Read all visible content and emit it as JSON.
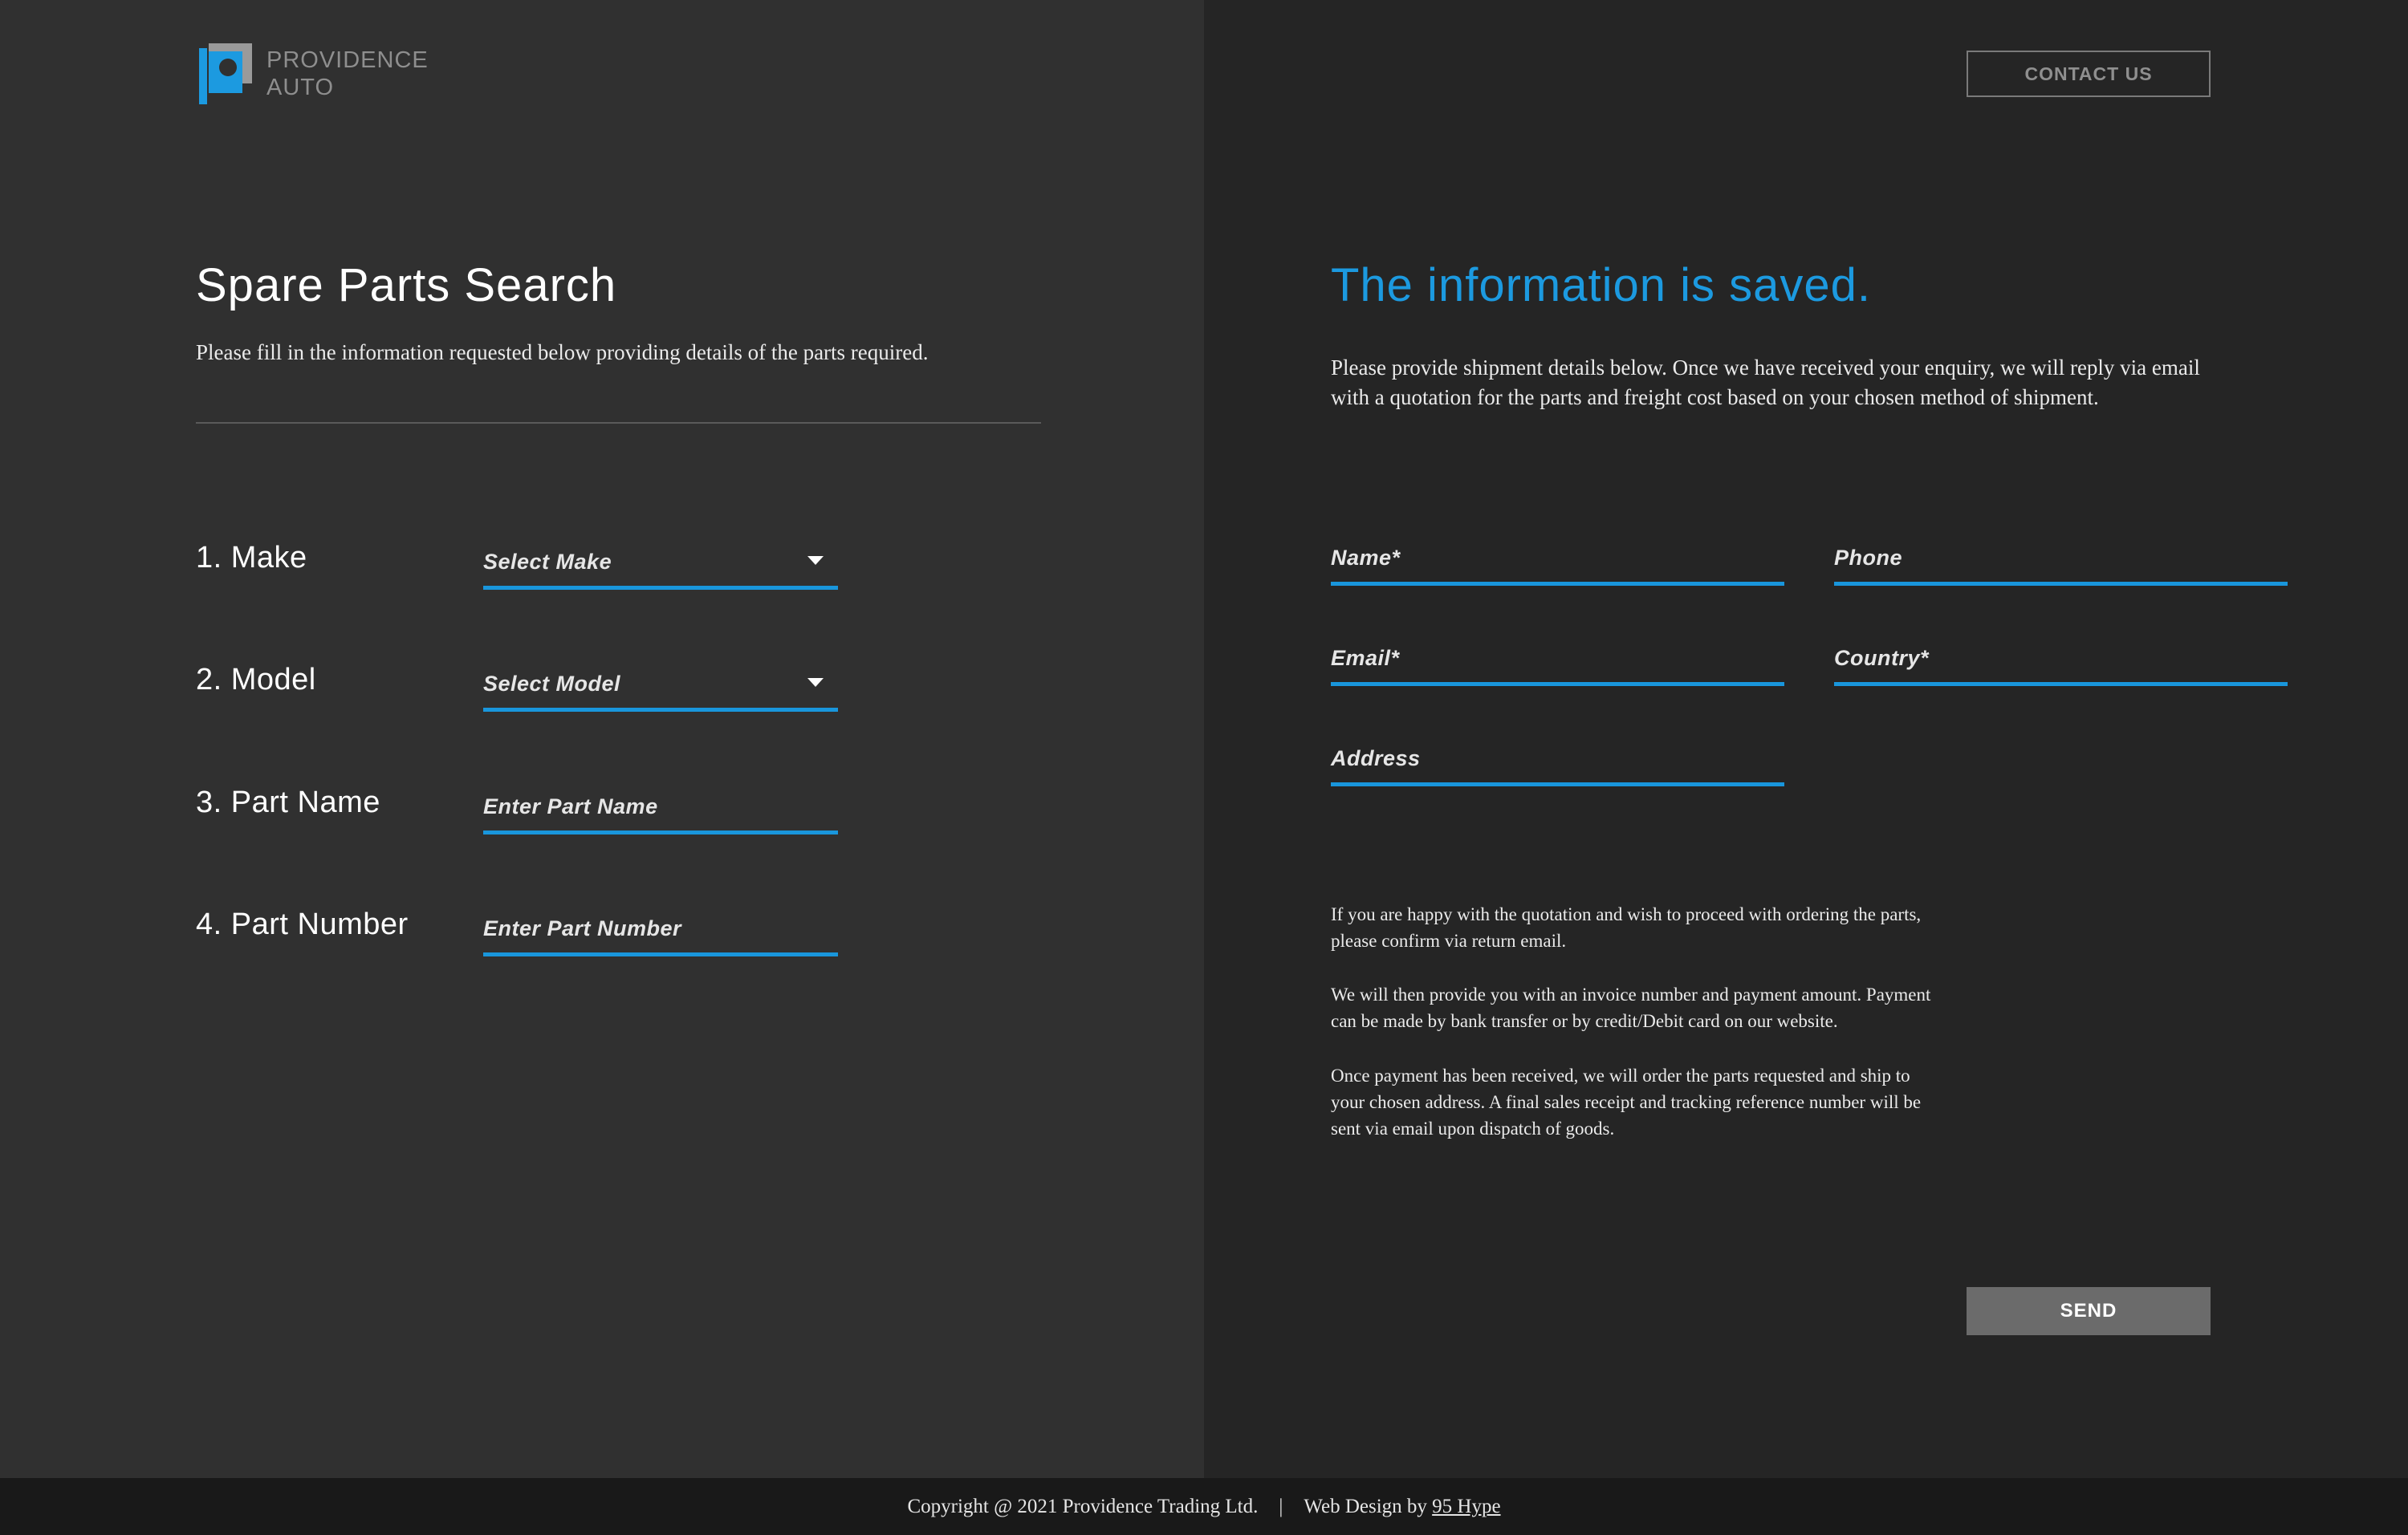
{
  "brand": {
    "line1": "PROVIDENCE",
    "line2": "AUTO",
    "logo_icon": "providence-p-logo",
    "accent_color": "#1c9ae0"
  },
  "header": {
    "contact_label": "CONTACT US"
  },
  "search": {
    "title": "Spare Parts Search",
    "subtitle": "Please fill in the information requested below providing details of the parts required.",
    "rows": [
      {
        "label": "1. Make",
        "placeholder": "Select Make",
        "type": "select"
      },
      {
        "label": "2. Model",
        "placeholder": "Select Model",
        "type": "select"
      },
      {
        "label": "3. Part Name",
        "placeholder": "Enter Part Name",
        "type": "input"
      },
      {
        "label": "4. Part Number",
        "placeholder": "Enter Part Number",
        "type": "input"
      }
    ]
  },
  "shipment": {
    "title": "The information is saved.",
    "subtitle": "Please provide shipment details below. Once we have received your enquiry, we will reply via email with a quotation for the parts and freight cost based on your chosen method of shipment.",
    "fields": {
      "name": "Name*",
      "phone": "Phone",
      "email": "Email*",
      "country": "Country*",
      "address": "Address"
    },
    "info": [
      "If you are happy with the quotation and wish to proceed with ordering the parts, please confirm via return email.",
      "We will then provide you with an invoice number and payment amount. Payment can be made by bank transfer or by credit/Debit card on our website.",
      "Once payment has been received, we will order the parts requested and ship to your chosen address. A final sales receipt and tracking reference number will be sent via email upon dispatch of goods."
    ],
    "send_label": "SEND"
  },
  "footer": {
    "copyright": "Copyright @ 2021 Providence Trading Ltd.",
    "separator": "|",
    "design_prefix": "Web Design by ",
    "design_link": "95 Hype"
  }
}
